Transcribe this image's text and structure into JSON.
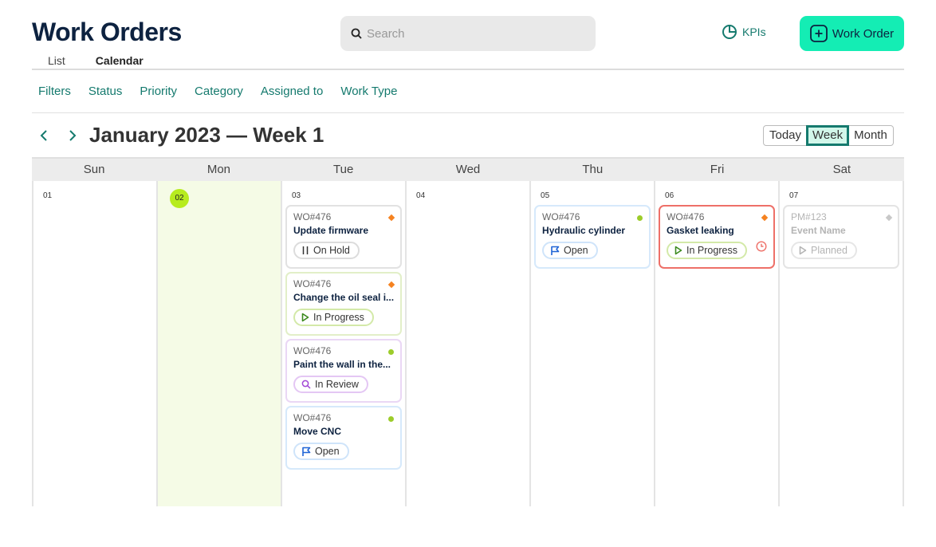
{
  "header": {
    "title": "Work Orders",
    "view_tabs": [
      {
        "label": "List",
        "active": false
      },
      {
        "label": "Calendar",
        "active": true
      }
    ],
    "search_placeholder": "Search",
    "kpis_label": "KPIs",
    "new_work_order_label": "Work Order"
  },
  "filters": [
    "Filters",
    "Status",
    "Priority",
    "Category",
    "Assigned to",
    "Work Type"
  ],
  "calendar": {
    "period_title": "January 2023 — Week 1",
    "range_options": [
      {
        "label": "Today",
        "active": false
      },
      {
        "label": "Week",
        "active": true
      },
      {
        "label": "Month",
        "active": false
      }
    ],
    "weekdays": [
      "Sun",
      "Mon",
      "Tue",
      "Wed",
      "Thu",
      "Fri",
      "Sat"
    ],
    "days": [
      {
        "date": "01",
        "today": false,
        "events": []
      },
      {
        "date": "02",
        "today": true,
        "events": []
      },
      {
        "date": "03",
        "today": false,
        "events": [
          {
            "id": "WO#476",
            "name": "Update firmware",
            "status": "On Hold",
            "status_key": "onhold",
            "priority": "high"
          },
          {
            "id": "WO#476",
            "name": "Change the oil seal i...",
            "status": "In Progress",
            "status_key": "progress",
            "priority": "high"
          },
          {
            "id": "WO#476",
            "name": "Paint the wall in the...",
            "status": "In Review",
            "status_key": "review",
            "priority": "low"
          },
          {
            "id": "WO#476",
            "name": "Move CNC",
            "status": "Open",
            "status_key": "open",
            "priority": "low"
          }
        ]
      },
      {
        "date": "04",
        "today": false,
        "events": []
      },
      {
        "date": "05",
        "today": false,
        "events": [
          {
            "id": "WO#476",
            "name": "Hydraulic cylinder",
            "status": "Open",
            "status_key": "open",
            "priority": "low"
          }
        ]
      },
      {
        "date": "06",
        "today": false,
        "events": [
          {
            "id": "WO#476",
            "name": "Gasket leaking",
            "status": "In Progress",
            "status_key": "late",
            "priority": "high",
            "overdue": true
          }
        ]
      },
      {
        "date": "07",
        "today": false,
        "events": [
          {
            "id": "PM#123",
            "name": "Event Name",
            "status": "Planned",
            "status_key": "planned",
            "priority": "none"
          }
        ]
      }
    ]
  },
  "colors": {
    "brand_dark": "#0d2240",
    "accent_teal": "#157a6e",
    "cta_green": "#14edb4",
    "today_highlight": "#b7ec1e",
    "priority_high": "#f58220",
    "priority_low": "#9ccc2a",
    "priority_none": "#c8c8c8",
    "overdue_red": "#ee7068"
  }
}
